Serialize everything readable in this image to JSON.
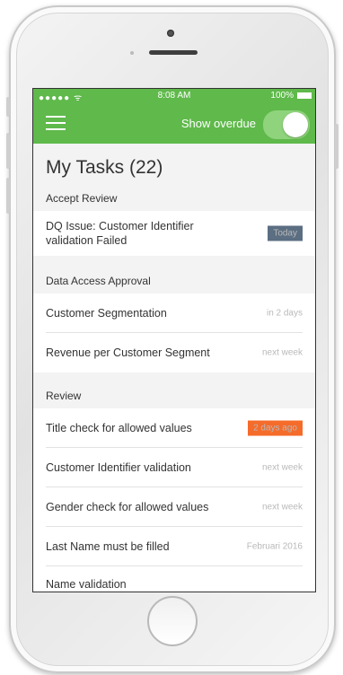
{
  "status_bar": {
    "carrier": "●●●●● ᯤ",
    "time": "8:08 AM",
    "battery": "100%"
  },
  "header": {
    "overdue_label": "Show overdue"
  },
  "page": {
    "title": "My Tasks (22)"
  },
  "sections": [
    {
      "header": "Accept Review",
      "items": [
        {
          "title": "DQ Issue: Customer Identifier validation Failed",
          "meta": "Today",
          "badge": "today"
        }
      ]
    },
    {
      "header": "Data Access Approval",
      "items": [
        {
          "title": "Customer Segmentation",
          "meta": "in 2 days"
        },
        {
          "title": "Revenue per Customer Segment",
          "meta": "next week"
        }
      ]
    },
    {
      "header": "Review",
      "items": [
        {
          "title": "Title check for allowed values",
          "meta": "2 days ago",
          "badge": "ago"
        },
        {
          "title": "Customer Identifier validation",
          "meta": "next week"
        },
        {
          "title": "Gender check for allowed values",
          "meta": "next week"
        },
        {
          "title": "Last Name must be filled",
          "meta": "Februari 2016"
        },
        {
          "title": "Name validation",
          "meta": ""
        }
      ]
    }
  ],
  "colors": {
    "brand": "#5fb94b",
    "today_badge": "#5b6e82",
    "overdue_badge": "#f56b2a"
  }
}
